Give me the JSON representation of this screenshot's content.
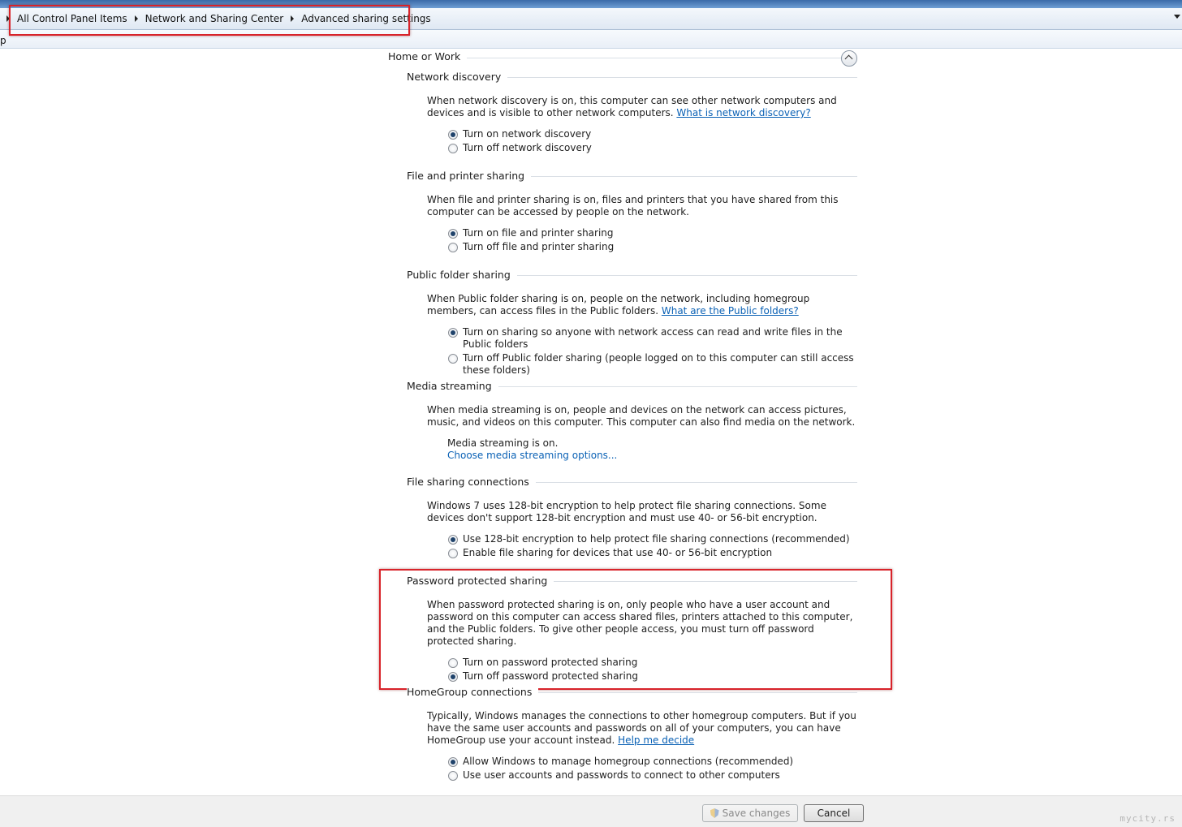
{
  "breadcrumb": {
    "items": [
      "All Control Panel Items",
      "Network and Sharing Center",
      "Advanced sharing settings"
    ]
  },
  "toolbar": {
    "fragment": "p"
  },
  "group": {
    "label": "Home or Work"
  },
  "sections": {
    "network_discovery": {
      "title": "Network discovery",
      "desc": "When network discovery is on, this computer can see other network computers and devices and is visible to other network computers.",
      "link": "What is network discovery?",
      "options": [
        "Turn on network discovery",
        "Turn off network discovery"
      ],
      "selected": 0
    },
    "file_printer": {
      "title": "File and printer sharing",
      "desc": "When file and printer sharing is on, files and printers that you have shared from this computer can be accessed by people on the network.",
      "options": [
        "Turn on file and printer sharing",
        "Turn off file and printer sharing"
      ],
      "selected": 0
    },
    "public_folder": {
      "title": "Public folder sharing",
      "desc": "When Public folder sharing is on, people on the network, including homegroup members, can access files in the Public folders.",
      "link": "What are the Public folders?",
      "options": [
        "Turn on sharing so anyone with network access can read and write files in the Public folders",
        "Turn off Public folder sharing (people logged on to this computer can still access these folders)"
      ],
      "selected": 0
    },
    "media_streaming": {
      "title": "Media streaming",
      "desc": "When media streaming is on, people and devices on the network can access pictures, music, and videos on this computer. This computer can also find media on the network.",
      "status": "Media streaming is on.",
      "link": "Choose media streaming options..."
    },
    "file_sharing_connections": {
      "title": "File sharing connections",
      "desc": "Windows 7 uses 128-bit encryption to help protect file sharing connections. Some devices don't support 128-bit encryption and must use 40- or 56-bit encryption.",
      "options": [
        "Use 128-bit encryption to help protect file sharing connections (recommended)",
        "Enable file sharing for devices that use 40- or 56-bit encryption"
      ],
      "selected": 0
    },
    "password_protected": {
      "title": "Password protected sharing",
      "desc": "When password protected sharing is on, only people who have a user account and password on this computer can access shared files, printers attached to this computer, and the Public folders. To give other people access, you must turn off password protected sharing.",
      "options": [
        "Turn on password protected sharing",
        "Turn off password protected sharing"
      ],
      "selected": 1
    },
    "homegroup": {
      "title": "HomeGroup connections",
      "desc": "Typically, Windows manages the connections to other homegroup computers. But if you have the same user accounts and passwords on all of your computers, you can have HomeGroup use your account instead.",
      "link": "Help me decide",
      "options": [
        "Allow Windows to manage homegroup connections (recommended)",
        "Use user accounts and passwords to connect to other computers"
      ],
      "selected": 0
    }
  },
  "buttons": {
    "save": "Save changes",
    "cancel": "Cancel"
  },
  "watermark": "mycity.rs",
  "colors": {
    "highlight": "#d8232a",
    "link": "#0a61b5",
    "radio_selected": "#20436b"
  }
}
